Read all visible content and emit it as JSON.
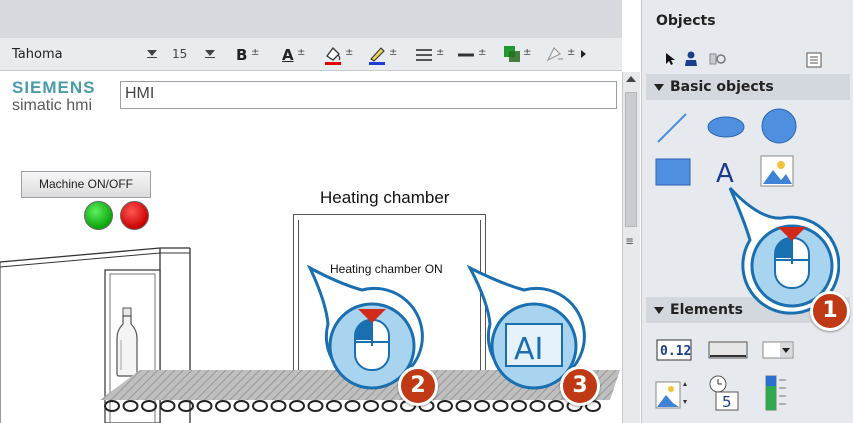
{
  "toolbar": {
    "font_family": "Tahoma",
    "font_size": "15",
    "bold_label": "B",
    "font_color_label": "A",
    "icons": [
      "bold-icon",
      "font-color-icon",
      "fill-color-icon",
      "line-color-icon",
      "line-style-icon",
      "line-width-icon",
      "pattern-icon",
      "shadow-icon",
      "overflow-icon"
    ]
  },
  "header": {
    "brand": "SIEMENS",
    "product": "simatic hmi",
    "screen_title": "HMI"
  },
  "screen": {
    "machine_button": "Machine ON/OFF",
    "chamber_title": "Heating chamber",
    "chamber_text": "Heating chamber ON",
    "lamps": [
      "green",
      "red"
    ]
  },
  "panel": {
    "title": "Objects",
    "tools": [
      "pointer-icon",
      "user-icon",
      "settings-icon",
      "list-view-icon"
    ],
    "basic_objects_label": "Basic objects",
    "basic_objects": [
      "line-icon",
      "ellipse-icon",
      "circle-icon",
      "rectangle-icon",
      "text-field-icon",
      "graphic-view-icon"
    ],
    "elements_label": "Elements",
    "elements": [
      "io-field-icon",
      "button-icon",
      "symbolic-io-icon",
      "graphic-io-icon",
      "date-time-icon",
      "bar-icon"
    ]
  },
  "callouts": [
    {
      "number": "1",
      "icon": "mouse-click-icon"
    },
    {
      "number": "2",
      "icon": "mouse-click-icon"
    },
    {
      "number": "3",
      "icon": "text-cursor-icon",
      "label": "AI"
    }
  ],
  "colors": {
    "brand": "#4a9da8",
    "callout_badge": "#bf3a14",
    "callout_bubble": "#a9d4ef",
    "callout_border": "#1a6fb0"
  }
}
